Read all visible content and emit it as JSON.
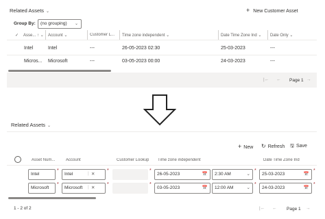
{
  "top": {
    "title": "Related Assets",
    "new_button": "New Customer Asset",
    "group_by_label": "Group By:",
    "group_by_value": "(no grouping)",
    "columns": [
      "Asse...",
      "Account",
      "Customer L...",
      "Time zone independent",
      "Date Time Zone Ind",
      "Date Only"
    ],
    "rows": [
      [
        "Intel",
        "Intel",
        "---",
        "26-05-2023 02:30",
        "25-03-2023",
        "---"
      ],
      [
        "Micros...",
        "Microsoft",
        "---",
        "03-05-2023 00:00",
        "24-03-2023",
        "---"
      ]
    ],
    "pager": "Page 1"
  },
  "bottom": {
    "title": "Related Assets",
    "toolbar": {
      "new": "New",
      "refresh": "Refresh",
      "save": "Save"
    },
    "columns": [
      "Asset Num...",
      "Account",
      "Customer Lookup",
      "Time zone independent",
      "Date Time Zone Ind"
    ],
    "rows": [
      {
        "asset": "Intel",
        "account": "Intel",
        "date": "26-05-2023",
        "time": "2:30 AM",
        "tzdate": "25-03-2023"
      },
      {
        "asset": "Microsoft",
        "account": "Microsoft",
        "date": "03-05-2023",
        "time": "12:00 AM",
        "tzdate": "24-03-2023"
      }
    ],
    "count": "1 - 2 of 2",
    "pager": "Page 1"
  }
}
